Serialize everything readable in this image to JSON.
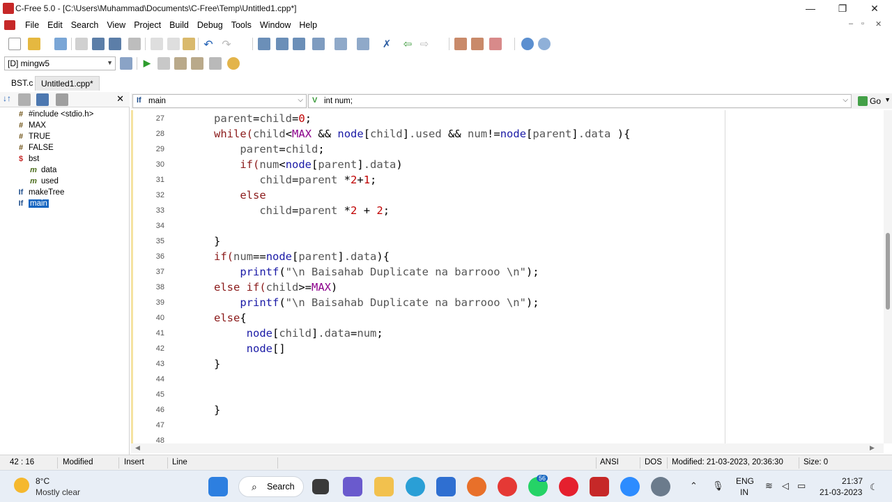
{
  "window": {
    "title": "C-Free 5.0 - [C:\\Users\\Muhammad\\Documents\\C-Free\\Temp\\Untitled1.cpp*]",
    "controls": {
      "minimize": "—",
      "maximize": "❐",
      "close": "✕"
    }
  },
  "menu": {
    "items": [
      "File",
      "Edit",
      "Search",
      "View",
      "Project",
      "Build",
      "Debug",
      "Tools",
      "Window",
      "Help"
    ],
    "mdi_controls": [
      "–",
      "▫",
      "✕"
    ]
  },
  "toolbar2": {
    "compiler": "[D] mingw5"
  },
  "tabs": [
    {
      "label": "BST.c"
    },
    {
      "label": "Untitled1.cpp*"
    }
  ],
  "symbols": {
    "close": "✕",
    "items": [
      {
        "icon": "#",
        "label": "#include <stdio.h>",
        "depth": 1
      },
      {
        "icon": "#",
        "label": "MAX",
        "depth": 1
      },
      {
        "icon": "#",
        "label": "TRUE",
        "depth": 1
      },
      {
        "icon": "#",
        "label": "FALSE",
        "depth": 1
      },
      {
        "icon": "S",
        "label": "bst",
        "depth": 1
      },
      {
        "icon": "m",
        "label": "data",
        "depth": 2
      },
      {
        "icon": "m",
        "label": "used",
        "depth": 2
      },
      {
        "icon": "f",
        "label": "makeTree",
        "depth": 1
      },
      {
        "icon": "f",
        "label": "main",
        "depth": 1,
        "selected": true
      }
    ]
  },
  "editor": {
    "function_combo": "main",
    "symbol_combo": "int num;",
    "go_label": "Go",
    "lines": [
      {
        "n": "27",
        "code": [
          [
            "      ",
            "id"
          ],
          [
            "parent",
            "id"
          ],
          [
            "=",
            "op"
          ],
          [
            "child",
            "id"
          ],
          [
            "=",
            "op"
          ],
          [
            "0",
            "num"
          ],
          [
            ";",
            "pn"
          ]
        ]
      },
      {
        "n": "28",
        "code": [
          [
            "      ",
            "id"
          ],
          [
            "while",
            "kw"
          ],
          [
            "(",
            "kw"
          ],
          [
            "child",
            "id"
          ],
          [
            "<",
            "op"
          ],
          [
            "MAX",
            "mac"
          ],
          [
            " && ",
            "op"
          ],
          [
            "node",
            "fn"
          ],
          [
            "[",
            "pn"
          ],
          [
            "child",
            "id"
          ],
          [
            "]",
            "pn"
          ],
          [
            ".used",
            "id"
          ],
          [
            " && ",
            "op"
          ],
          [
            "num",
            "id"
          ],
          [
            "!=",
            "op"
          ],
          [
            "node",
            "fn"
          ],
          [
            "[",
            "pn"
          ],
          [
            "parent",
            "id"
          ],
          [
            "]",
            "pn"
          ],
          [
            ".data",
            "id"
          ],
          [
            " ){",
            "pn"
          ]
        ]
      },
      {
        "n": "29",
        "code": [
          [
            "          ",
            "id"
          ],
          [
            "parent",
            "id"
          ],
          [
            "=",
            "op"
          ],
          [
            "child",
            "id"
          ],
          [
            ";",
            "pn"
          ]
        ]
      },
      {
        "n": "30",
        "code": [
          [
            "          ",
            "id"
          ],
          [
            "if",
            "kw"
          ],
          [
            "(",
            "kw"
          ],
          [
            "num",
            "id"
          ],
          [
            "<",
            "op"
          ],
          [
            "node",
            "fn"
          ],
          [
            "[",
            "pn"
          ],
          [
            "parent",
            "id"
          ],
          [
            "]",
            "pn"
          ],
          [
            ".data",
            "id"
          ],
          [
            ")",
            "pn"
          ]
        ]
      },
      {
        "n": "31",
        "code": [
          [
            "             ",
            "id"
          ],
          [
            "child",
            "id"
          ],
          [
            "=",
            "op"
          ],
          [
            "parent",
            "id"
          ],
          [
            " *",
            "op"
          ],
          [
            "2",
            "num"
          ],
          [
            "+",
            "op"
          ],
          [
            "1",
            "num"
          ],
          [
            ";",
            "pn"
          ]
        ]
      },
      {
        "n": "32",
        "code": [
          [
            "          ",
            "id"
          ],
          [
            "else",
            "kw"
          ]
        ]
      },
      {
        "n": "33",
        "code": [
          [
            "             ",
            "id"
          ],
          [
            "child",
            "id"
          ],
          [
            "=",
            "op"
          ],
          [
            "parent",
            "id"
          ],
          [
            " *",
            "op"
          ],
          [
            "2",
            "num"
          ],
          [
            " + ",
            "op"
          ],
          [
            "2",
            "num"
          ],
          [
            ";",
            "pn"
          ]
        ]
      },
      {
        "n": "34",
        "code": []
      },
      {
        "n": "35",
        "code": [
          [
            "      ",
            "id"
          ],
          [
            "}",
            "pn"
          ]
        ]
      },
      {
        "n": "36",
        "code": [
          [
            "      ",
            "id"
          ],
          [
            "if",
            "kw"
          ],
          [
            "(",
            "kw"
          ],
          [
            "num",
            "id"
          ],
          [
            "==",
            "op"
          ],
          [
            "node",
            "fn"
          ],
          [
            "[",
            "pn"
          ],
          [
            "parent",
            "id"
          ],
          [
            "]",
            "pn"
          ],
          [
            ".data",
            "id"
          ],
          [
            "){",
            "pn"
          ]
        ]
      },
      {
        "n": "37",
        "code": [
          [
            "          ",
            "id"
          ],
          [
            "printf",
            "fn"
          ],
          [
            "(",
            "pn"
          ],
          [
            "\"\\n Baisahab Duplicate na barrooo \\n\"",
            "str"
          ],
          [
            ");",
            "pn"
          ]
        ]
      },
      {
        "n": "38",
        "code": [
          [
            "      ",
            "id"
          ],
          [
            "else if",
            "kw"
          ],
          [
            "(",
            "kw"
          ],
          [
            "child",
            "id"
          ],
          [
            ">=",
            "op"
          ],
          [
            "MAX",
            "mac"
          ],
          [
            ")",
            "pn"
          ]
        ]
      },
      {
        "n": "39",
        "code": [
          [
            "          ",
            "id"
          ],
          [
            "printf",
            "fn"
          ],
          [
            "(",
            "pn"
          ],
          [
            "\"\\n Baisahab Duplicate na barrooo \\n\"",
            "str"
          ],
          [
            ");",
            "pn"
          ]
        ]
      },
      {
        "n": "40",
        "code": [
          [
            "      ",
            "id"
          ],
          [
            "else",
            "kw"
          ],
          [
            "{",
            "pn"
          ]
        ]
      },
      {
        "n": "41",
        "code": [
          [
            "           ",
            "id"
          ],
          [
            "node",
            "fn"
          ],
          [
            "[",
            "pn"
          ],
          [
            "child",
            "id"
          ],
          [
            "]",
            "pn"
          ],
          [
            ".data",
            "id"
          ],
          [
            "=",
            "op"
          ],
          [
            "num",
            "id"
          ],
          [
            ";",
            "pn"
          ]
        ]
      },
      {
        "n": "42",
        "code": [
          [
            "           ",
            "id"
          ],
          [
            "node",
            "fn"
          ],
          [
            "[]",
            "pn"
          ]
        ]
      },
      {
        "n": "43",
        "code": [
          [
            "      ",
            "id"
          ],
          [
            "}",
            "pn"
          ]
        ]
      },
      {
        "n": "44",
        "code": []
      },
      {
        "n": "45",
        "code": []
      },
      {
        "n": "46",
        "code": [
          [
            "      ",
            "id"
          ],
          [
            "}",
            "pn"
          ]
        ]
      },
      {
        "n": "47",
        "code": []
      },
      {
        "n": "48",
        "code": []
      }
    ]
  },
  "status": {
    "position": "42 : 16",
    "modified": "Modified",
    "insert": "Insert",
    "line": "Line",
    "encoding": "ANSI",
    "format": "DOS",
    "modified_time": "Modified: 21-03-2023, 20:36:30",
    "size": "Size: 0"
  },
  "taskbar": {
    "weather_temp": "8°C",
    "weather_desc": "Mostly clear",
    "search_label": "Search",
    "whatsapp_badge": "56",
    "lang_line1": "ENG",
    "lang_line2": "IN",
    "time": "21:37",
    "date": "21-03-2023"
  }
}
